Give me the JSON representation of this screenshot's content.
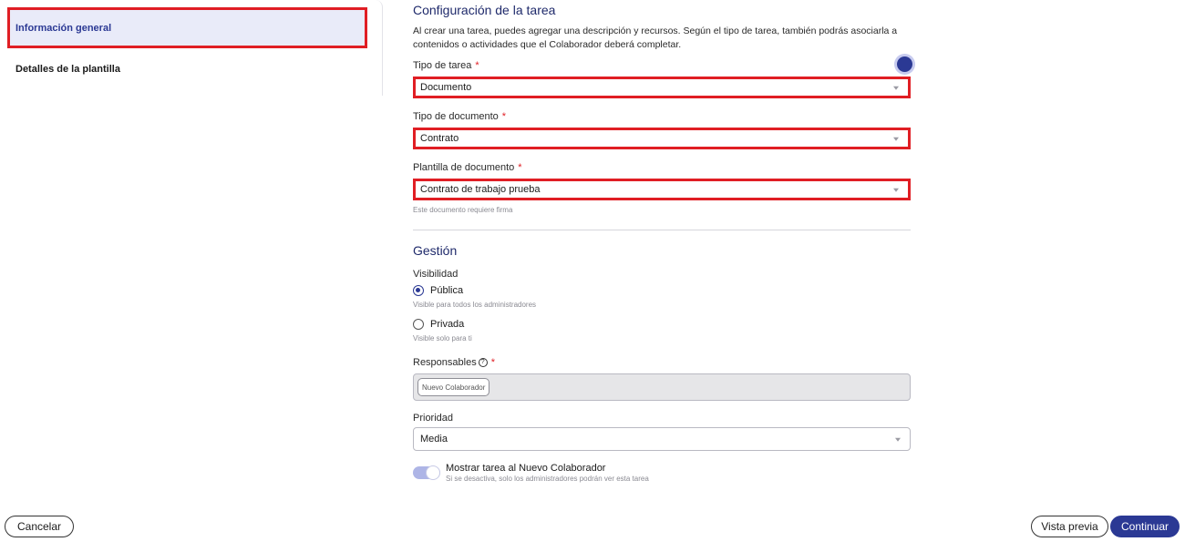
{
  "sidebar": {
    "items": [
      {
        "label": "Información general",
        "active": true
      },
      {
        "label": "Detalles de la plantilla",
        "active": false
      }
    ]
  },
  "task_config": {
    "title": "Configuración de la tarea",
    "description": "Al crear una tarea, puedes agregar una descripción y recursos. Según el tipo de tarea, también podrás asociarla a contenidos o actividades que el Colaborador deberá completar.",
    "task_type": {
      "label": "Tipo de tarea",
      "required_mark": "*",
      "value": "Documento"
    },
    "document_type": {
      "label": "Tipo de documento",
      "required_mark": "*",
      "value": "Contrato"
    },
    "document_template": {
      "label": "Plantilla de documento",
      "required_mark": "*",
      "value": "Contrato de trabajo prueba",
      "hint": "Este documento requiere firma"
    }
  },
  "management": {
    "title": "Gestión",
    "visibility": {
      "label": "Visibilidad",
      "options": [
        {
          "label": "Pública",
          "hint": "Visible para todos los administradores",
          "selected": true
        },
        {
          "label": "Privada",
          "hint": "Visible solo para ti",
          "selected": false
        }
      ]
    },
    "responsables": {
      "label": "Responsables",
      "help_glyph": "?",
      "required_mark": "*",
      "chips": [
        "Nuevo Colaborador"
      ]
    },
    "priority": {
      "label": "Prioridad",
      "value": "Media"
    },
    "show_task": {
      "label": "Mostrar tarea al Nuevo Colaborador",
      "hint": "Si se desactiva, solo los administradores podrán ver esta tarea",
      "enabled": true
    }
  },
  "footer": {
    "cancel_label": "Cancelar",
    "preview_label": "Vista previa",
    "continue_label": "Continuar"
  },
  "colors": {
    "primary": "#2b3994",
    "highlight_border": "#e01e24",
    "active_nav_bg": "#e9ebf9"
  }
}
